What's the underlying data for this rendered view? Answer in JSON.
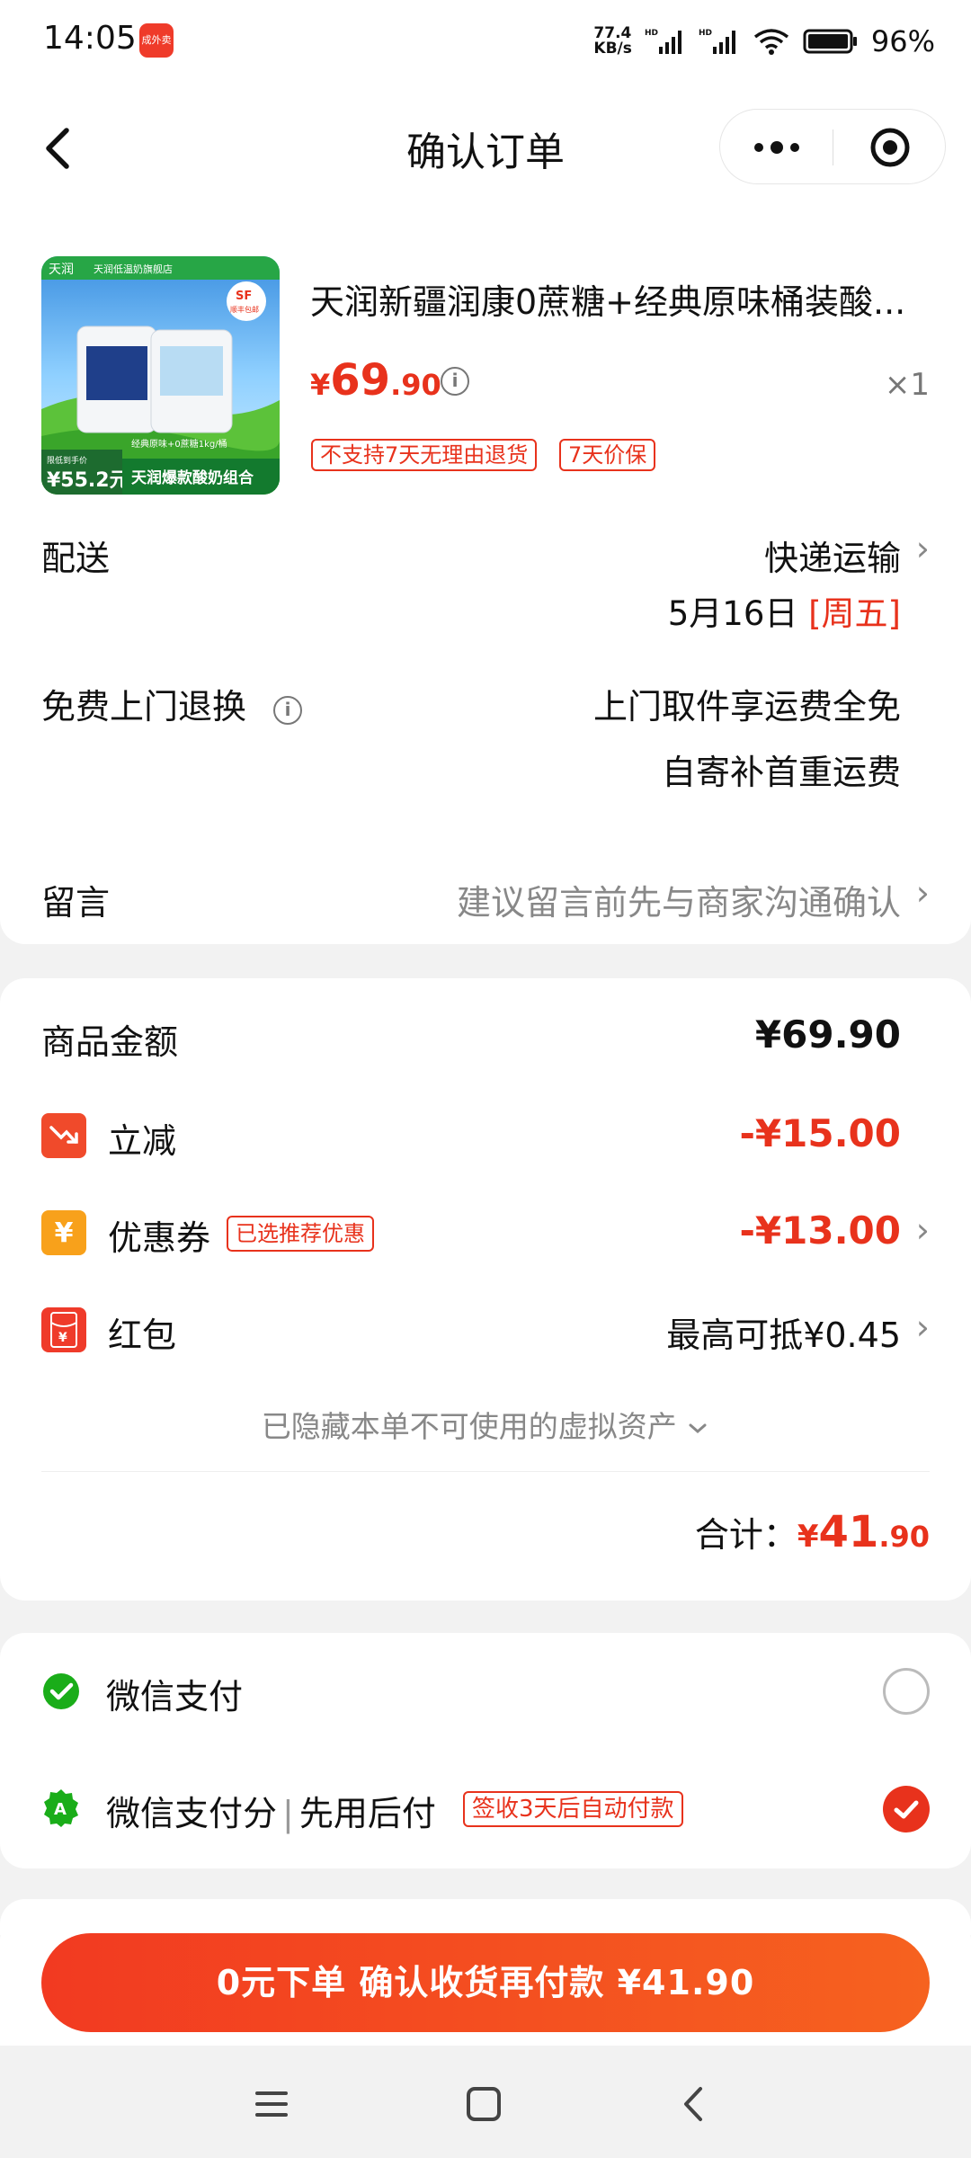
{
  "status_bar": {
    "time": "14:05",
    "app_icon_text": "成外卖",
    "net_speed_top": "77.4",
    "net_speed_bottom": "KB/s",
    "battery": "96%"
  },
  "nav": {
    "title": "确认订单"
  },
  "product": {
    "name": "天润新疆润康0蔗糖+经典原味桶装酸...",
    "price_currency": "¥",
    "price_int": "69",
    "price_dec": ".90",
    "quantity": "×1",
    "tags": [
      "不支持7天无理由退货",
      "7天价保"
    ],
    "image_texts": {
      "brand": "天润",
      "shop": "天润低温奶旗舰店",
      "sf": "SF",
      "sf_note": "顺丰包邮",
      "flavor": "经典原味+0蔗糖1kg/桶",
      "promo_label": "限低到手价",
      "promo_price": "¥55.2元",
      "combo": "天润爆款酸奶组合"
    }
  },
  "delivery": {
    "label": "配送",
    "method": "快递运输",
    "date": "5月16日",
    "weekday": "[周五]"
  },
  "returns": {
    "label": "免费上门退换",
    "line1": "上门取件享运费全免",
    "line2": "自寄补首重运费"
  },
  "message": {
    "label": "留言",
    "placeholder": "建议留言前先与商家沟通确认"
  },
  "amounts": {
    "goods_label": "商品金额",
    "goods_value": "¥69.90",
    "discount_label": "立减",
    "discount_value": "-¥15.00",
    "coupon_label": "优惠券",
    "coupon_tag": "已选推荐优惠",
    "coupon_value": "-¥13.00",
    "redpacket_label": "红包",
    "redpacket_value": "最高可抵¥0.45",
    "hidden_assets": "已隐藏本单不可使用的虚拟资产",
    "total_label": "合计：",
    "total_currency": "¥",
    "total_int": "41",
    "total_dec": ".90"
  },
  "payment": {
    "wechat_label": "微信支付",
    "score_label_a": "微信支付分",
    "score_label_b": "先用后付",
    "score_tag": "签收3天后自动付款",
    "selected": "wechat_score"
  },
  "cta": {
    "label": "0元下单 确认收货再付款 ¥41.90"
  },
  "colors": {
    "accent": "#e8321c",
    "wechat_green": "#1aad19"
  }
}
